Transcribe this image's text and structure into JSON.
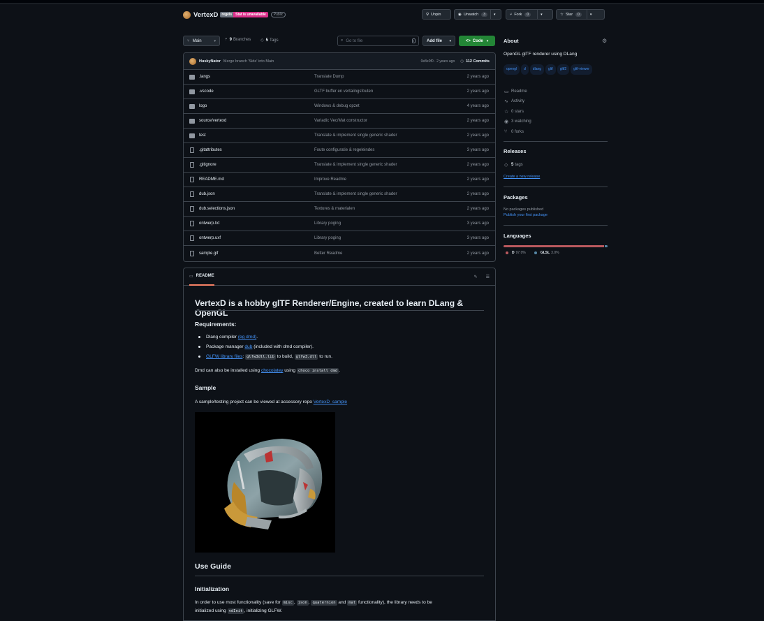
{
  "repo": {
    "name": "VertexD",
    "badge_left": "regels",
    "badge_right": "Stat is unavailable",
    "visibility": "Public"
  },
  "header_buttons": {
    "unpin": "Unpin",
    "unwatch": "Unwatch",
    "unwatch_count": "3",
    "fork": "Fork",
    "fork_count": "0",
    "star": "Star",
    "star_count": "0"
  },
  "toolbar": {
    "branch": "Main",
    "branches_count": "9",
    "branches_label": "Branches",
    "tags_count": "5",
    "tags_label": "Tags",
    "search_placeholder": "Go to file",
    "search_key": "t",
    "add_file": "Add file",
    "code": "Code"
  },
  "commit": {
    "author": "HuskyNator",
    "message": "Merge branch 'Side' into Main",
    "hash_time": "0e8e0f0 · 2 years ago",
    "count": "112 Commits"
  },
  "files": [
    {
      "type": "folder",
      "name": ".langs",
      "message": "Translate Dump",
      "date": "2 years ago"
    },
    {
      "type": "folder",
      "name": ".vscode",
      "message": "GLTF buffer en vertalingsfouten",
      "date": "2 years ago"
    },
    {
      "type": "folder",
      "name": "logo",
      "message": "Windows & debug opzet",
      "date": "4 years ago"
    },
    {
      "type": "folder",
      "name": "source/vertexd",
      "message": "Variadic Vec/Mat constructor",
      "date": "2 years ago"
    },
    {
      "type": "folder",
      "name": "test",
      "message": "Translate & implement single generic shader",
      "date": "2 years ago"
    },
    {
      "type": "file",
      "name": ".gitattributes",
      "message": "Foute configuratie & regeleindes",
      "date": "3 years ago"
    },
    {
      "type": "file",
      "name": ".gitignore",
      "message": "Translate & implement single generic shader",
      "date": "2 years ago"
    },
    {
      "type": "file",
      "name": "README.md",
      "message": "Improve Readme",
      "date": "2 years ago"
    },
    {
      "type": "file",
      "name": "dub.json",
      "message": "Translate & implement single generic shader",
      "date": "2 years ago"
    },
    {
      "type": "file",
      "name": "dub.selections.json",
      "message": "Textures & materialen",
      "date": "2 years ago"
    },
    {
      "type": "file",
      "name": "ontwerp.txt",
      "message": "Library poging",
      "date": "3 years ago"
    },
    {
      "type": "file",
      "name": "ontwerp.uxf",
      "message": "Library poging",
      "date": "3 years ago"
    },
    {
      "type": "file",
      "name": "sample.gif",
      "message": "Better Readme",
      "date": "2 years ago"
    }
  ],
  "readme": {
    "tab": "README",
    "title": "VertexD is a hobby glTF Renderer/Engine, created to learn DLang & OpenGL",
    "requirements_heading": "Requirements:",
    "req1_text": "Dlang compiler ",
    "req1_link": "(eg dmd)",
    "req1_end": ".",
    "req2_text": "Package manager ",
    "req2_link": "dub",
    "req2_end": " (included with dmd compiler).",
    "req3_link": "GLFW library files",
    "req3_mid": ": ",
    "req3_code1": "glfw3dll.lib",
    "req3_mid2": " to build, ",
    "req3_code2": "glfw3.dll",
    "req3_end": " to run.",
    "dmd_text": "Dmd can also be installed using ",
    "dmd_link": "chocolatey",
    "dmd_mid": " using ",
    "dmd_code": "choco install dmd",
    "dmd_end": ".",
    "sample_heading": "Sample",
    "sample_text": "A sample/testing project can be viewed at accessory repo ",
    "sample_link": "VertexD_sample",
    "use_guide_heading": "Use Guide",
    "init_heading": "Initialization",
    "init_text1": "In order to use most functionality (save for ",
    "init_code1": "misc",
    "init_sep1": ", ",
    "init_code2": "json",
    "init_sep2": ", ",
    "init_code3": "quaternion",
    "init_and": " and ",
    "init_code4": "mat",
    "init_text1_end": " functionality), the library needs to be",
    "init_text2": "initialized using ",
    "init_code5": "vdInit",
    "init_text2_end": ", initializing GLFW."
  },
  "about": {
    "heading": "About",
    "description": "OpenGL glTF renderer using DLang",
    "topics": [
      "opengl",
      "d",
      "dlang",
      "gltf",
      "gltf2",
      "gltf-viewer"
    ],
    "readme": "Readme",
    "activity": "Activity",
    "stars": "0 stars",
    "watching": "3 watching",
    "forks": "0 forks"
  },
  "releases": {
    "heading": "Releases",
    "tags_count": "5",
    "tags_label": "tags",
    "create_link": "Create a new release"
  },
  "packages": {
    "heading": "Packages",
    "none_text": "No packages published",
    "publish_link": "Publish your first package"
  },
  "languages": {
    "heading": "Languages",
    "items": [
      {
        "name": "D",
        "percent": "97.0%",
        "color": "#ba595e",
        "value": 97.0
      },
      {
        "name": "GLSL",
        "percent": "3.0%",
        "color": "#5686a5",
        "value": 3.0
      }
    ]
  }
}
